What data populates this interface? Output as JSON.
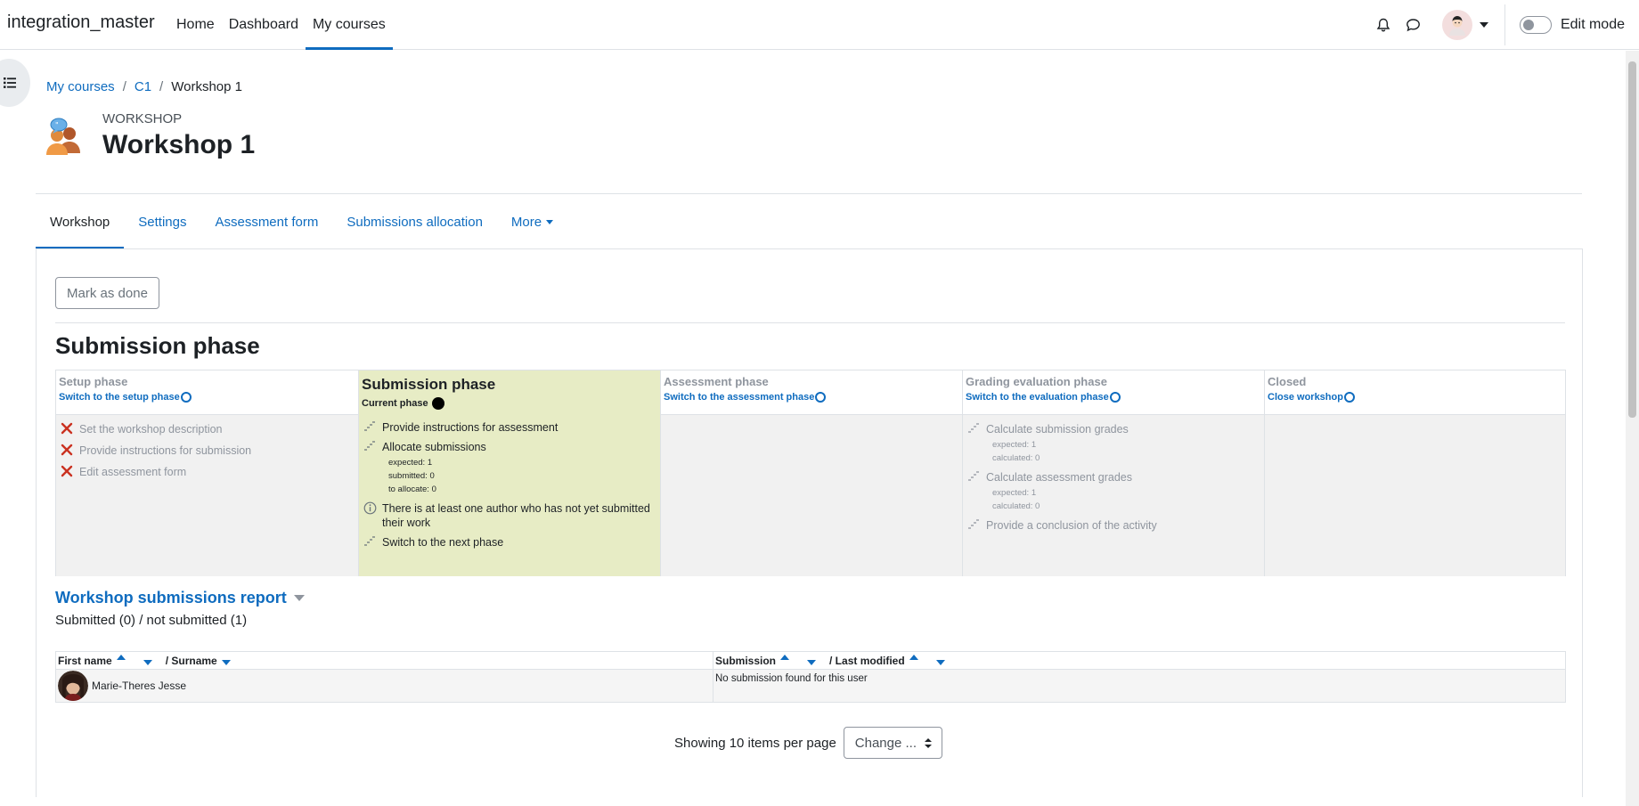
{
  "navbar": {
    "brand": "integration_master",
    "items": [
      {
        "label": "Home"
      },
      {
        "label": "Dashboard"
      },
      {
        "label": "My courses"
      }
    ],
    "edit_mode_label": "Edit mode"
  },
  "breadcrumb": {
    "items": [
      "My courses",
      "C1",
      "Workshop 1"
    ],
    "separator": "/"
  },
  "header": {
    "module_type": "WORKSHOP",
    "title": "Workshop 1"
  },
  "secondary_nav": {
    "items": [
      {
        "label": "Workshop"
      },
      {
        "label": "Settings"
      },
      {
        "label": "Assessment form"
      },
      {
        "label": "Submissions allocation"
      },
      {
        "label": "More"
      }
    ]
  },
  "main": {
    "mark_done": "Mark as done",
    "phase_heading": "Submission phase",
    "phases": {
      "setup": {
        "name": "Setup phase",
        "switch": "Switch to the setup phase",
        "tasks": [
          "Set the workshop description",
          "Provide instructions for submission",
          "Edit assessment form"
        ]
      },
      "submission": {
        "name": "Submission phase",
        "current_label": "Current phase",
        "tasks": {
          "t1": "Provide instructions for assessment",
          "t2": "Allocate submissions",
          "t2_details": [
            "expected: 1",
            "submitted: 0",
            "to allocate: 0"
          ],
          "t3": "There is at least one author who has not yet submitted their work",
          "t4": "Switch to the next phase"
        }
      },
      "assessment": {
        "name": "Assessment phase",
        "switch": "Switch to the assessment phase"
      },
      "evaluation": {
        "name": "Grading evaluation phase",
        "switch": "Switch to the evaluation phase",
        "tasks": {
          "t1": "Calculate submission grades",
          "t1_details": [
            "expected: 1",
            "calculated: 0"
          ],
          "t2": "Calculate assessment grades",
          "t2_details": [
            "expected: 1",
            "calculated: 0"
          ],
          "t3": "Provide a conclusion of the activity"
        }
      },
      "closed": {
        "name": "Closed",
        "switch": "Close workshop"
      }
    },
    "report": {
      "title": "Workshop submissions report",
      "summary": "Submitted (0) / not submitted (1)",
      "headers": {
        "first_name": "First name",
        "surname": "/ Surname",
        "submission": "Submission",
        "last_modified": "/ Last modified"
      },
      "rows": [
        {
          "name": "Marie-Theres Jesse",
          "submission": "No submission found for this user"
        }
      ]
    },
    "paging": {
      "label": "Showing 10 items per page",
      "select_value": "Change ..."
    }
  },
  "colors": {
    "link": "#0f6cbf",
    "current_phase_bg": "#e7ecc5",
    "phase_bg": "#f1f1f1",
    "fail_icon": "#ca3120"
  }
}
